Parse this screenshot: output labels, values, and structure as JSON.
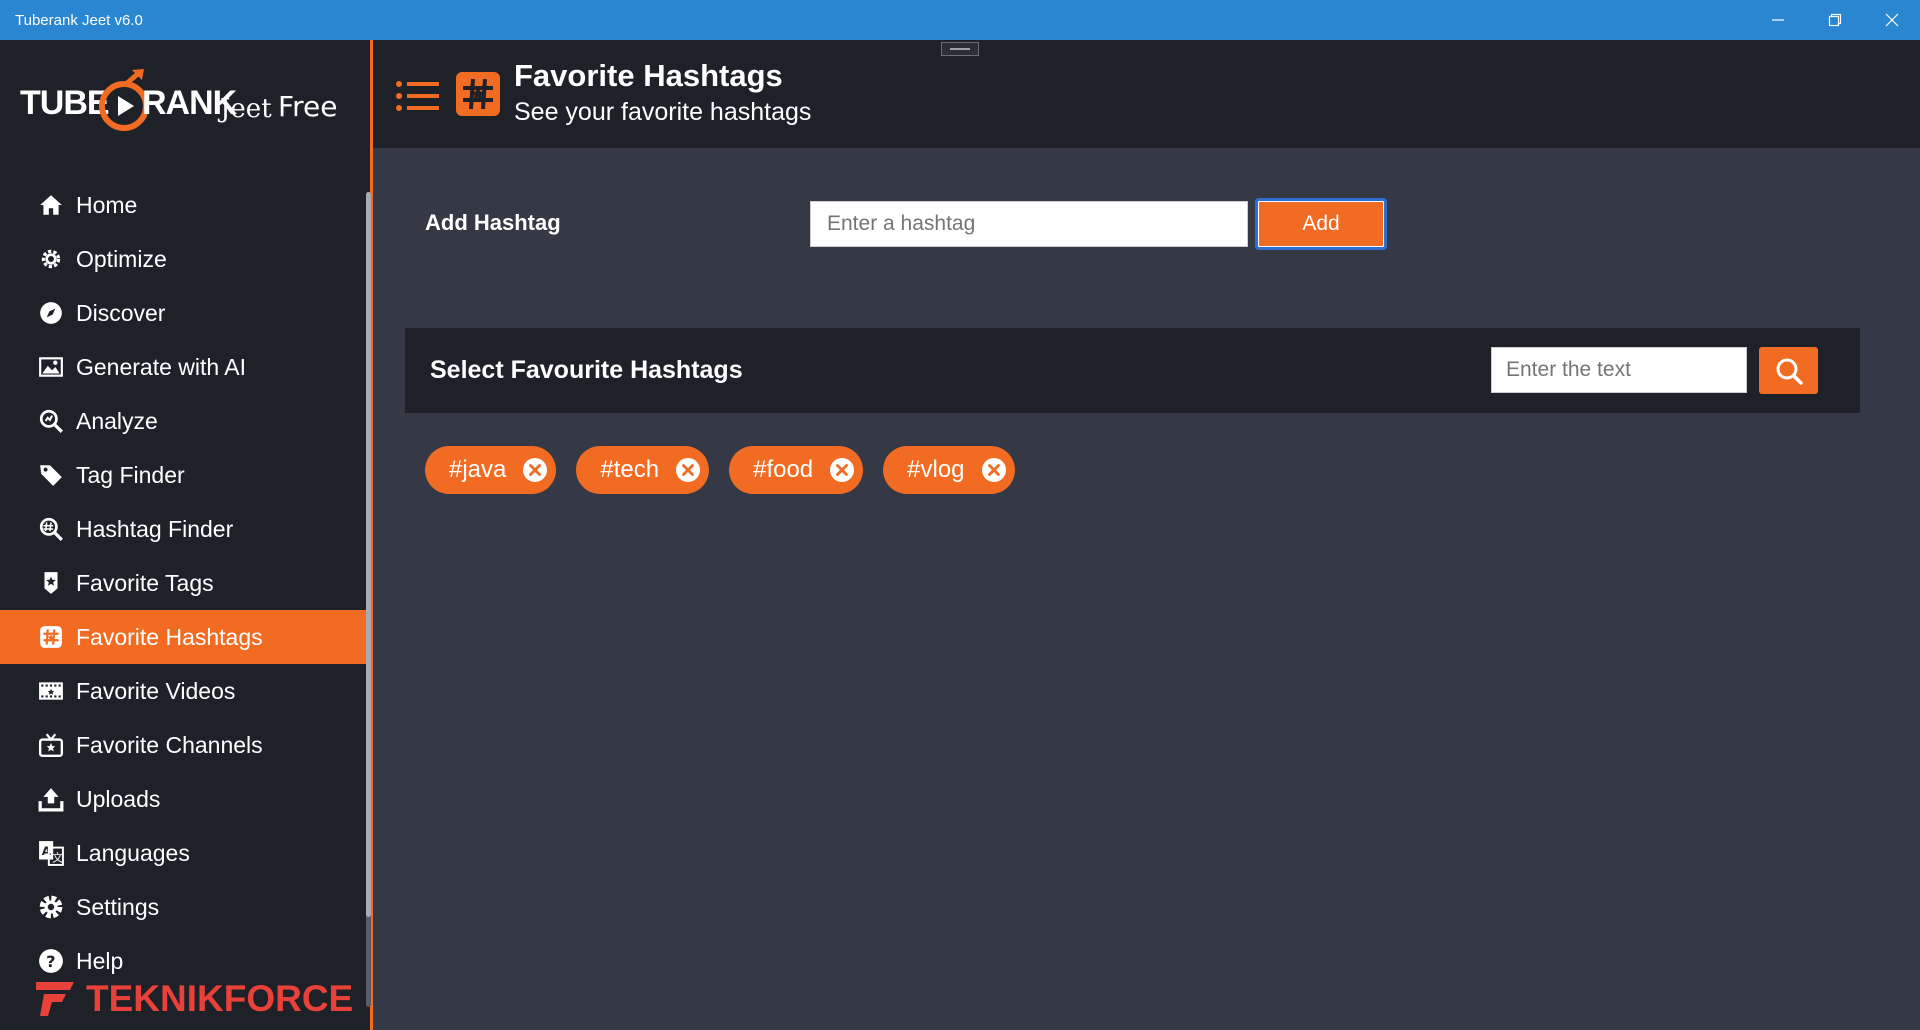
{
  "window": {
    "title": "Tuberank Jeet v6.0",
    "accent": "#f26b22",
    "titlebar_color": "#2a86d0"
  },
  "logo": {
    "tube": "TUBE",
    "rank": "RANK",
    "jeet": "Jeet",
    "edition": "Free"
  },
  "sidebar": {
    "items": [
      {
        "label": "Home",
        "icon": "home-icon"
      },
      {
        "label": "Optimize",
        "icon": "gear-icon"
      },
      {
        "label": "Discover",
        "icon": "compass-icon"
      },
      {
        "label": "Generate with AI",
        "icon": "image-icon"
      },
      {
        "label": "Analyze",
        "icon": "analyze-icon"
      },
      {
        "label": "Tag Finder",
        "icon": "tag-icon"
      },
      {
        "label": "Hashtag Finder",
        "icon": "hashtag-search-icon"
      },
      {
        "label": "Favorite Tags",
        "icon": "favorite-tag-icon"
      },
      {
        "label": "Favorite Hashtags",
        "icon": "favorite-hashtag-icon",
        "active": true
      },
      {
        "label": "Favorite Videos",
        "icon": "film-icon"
      },
      {
        "label": "Favorite Channels",
        "icon": "tv-icon"
      },
      {
        "label": "Uploads",
        "icon": "upload-icon"
      },
      {
        "label": "Languages",
        "icon": "translate-icon"
      },
      {
        "label": "Settings",
        "icon": "settings-icon"
      },
      {
        "label": "Help",
        "icon": "help-icon"
      }
    ],
    "brand": "TEKNIKFORCE"
  },
  "header": {
    "title": "Favorite Hashtags",
    "subtitle": "See your favorite hashtags"
  },
  "add_hashtag": {
    "label": "Add Hashtag",
    "placeholder": "Enter a hashtag",
    "button_label": "Add"
  },
  "favourites": {
    "title": "Select Favourite Hashtags",
    "search_placeholder": "Enter the text",
    "hashtags": [
      "#java",
      "#tech",
      "#food",
      "#vlog"
    ]
  }
}
